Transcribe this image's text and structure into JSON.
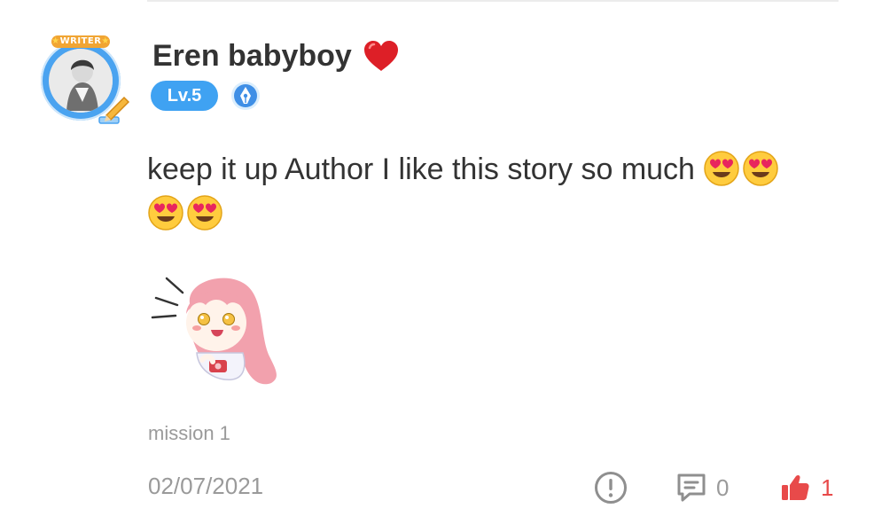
{
  "user": {
    "name": "Eren babyboy",
    "level": "Lv.5",
    "avatar_badge": "WRITER",
    "name_icon": "heart-icon"
  },
  "comment": {
    "text": "keep it up Author I like this story so much",
    "emoji_icon": "heart-eyes-emoji",
    "emoji_count": 4,
    "sticker_icon": "anime-girl-sticker",
    "tag": "mission 1",
    "date": "02/07/2021"
  },
  "actions": {
    "reply_count": "0",
    "like_count": "1"
  },
  "colors": {
    "accent_blue": "#3fa2f2",
    "like_red": "#e84a4a",
    "muted_gray": "#9a9a9a",
    "text": "#333333"
  }
}
